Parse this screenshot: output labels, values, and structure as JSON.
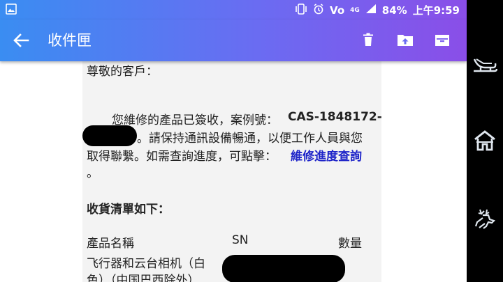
{
  "status": {
    "battery": "84%",
    "time": "上午9:59",
    "network": "4G",
    "volte": "Vo"
  },
  "appbar": {
    "title": "收件匣"
  },
  "email": {
    "greeting": "尊敬的客戶：",
    "line1": "您維修的產品已簽收，案例號：",
    "case_no": "CAS-1848172-",
    "line2": "。請保持通訊設備暢通，以便工作人員與您",
    "line3": "取得聯繫。如需查詢進度，可點擊：",
    "link": "維修進度查詢",
    "line4": "。",
    "list_title": "收貨清單如下：",
    "col_product": "產品名稱",
    "col_sn": "SN",
    "col_qty": "數量",
    "item_line1": "飞行器和云台相机（白",
    "item_line2": "色）（中国巴西除外）"
  }
}
